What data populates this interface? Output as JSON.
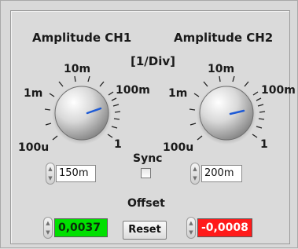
{
  "ch1": {
    "title": "Amplitude CH1",
    "ticks": [
      "100u",
      "1m",
      "10m",
      "100m",
      "1"
    ],
    "value": "150m"
  },
  "ch2": {
    "title": "Amplitude CH2",
    "ticks": [
      "100u",
      "1m",
      "10m",
      "100m",
      "1"
    ],
    "value": "200m"
  },
  "units_label": "[1/Div]",
  "sync": {
    "label": "Sync",
    "checked": false
  },
  "offset": {
    "label": "Offset",
    "ch1_value": "0,0037",
    "ch2_value": "-0,0008",
    "reset_label": "Reset",
    "ch1_color": "#00e000",
    "ch2_color": "#ff1a1a"
  },
  "icons": {
    "stepper_up": "▲",
    "stepper_down": "▼"
  },
  "colors": {
    "needle": "#1e5bd6"
  }
}
